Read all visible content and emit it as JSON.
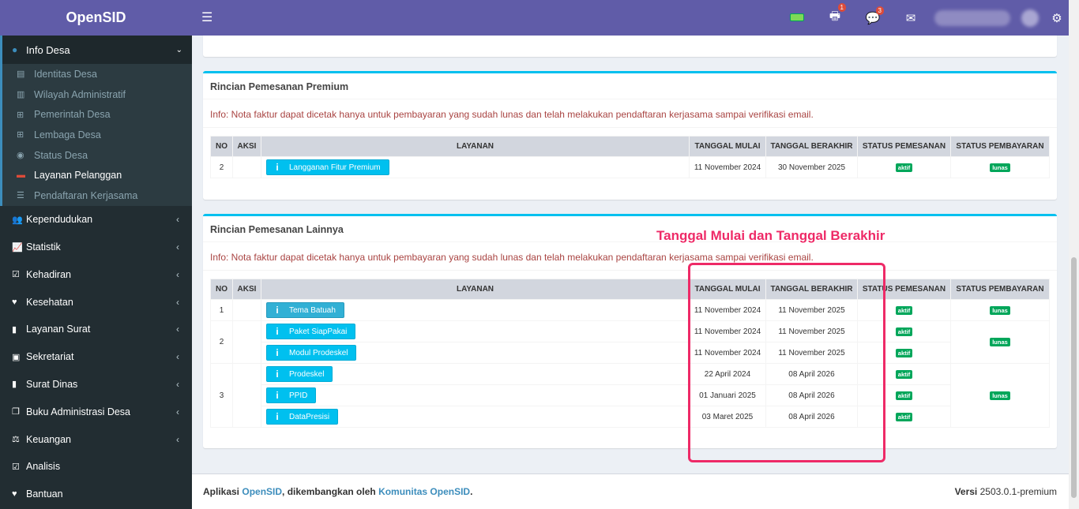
{
  "brand": "OpenSID",
  "sidebar": {
    "open_menu": {
      "label": "Info Desa",
      "icon": "palette-icon"
    },
    "sub_items": [
      {
        "label": "Identitas Desa",
        "icon": "id-card-icon"
      },
      {
        "label": "Wilayah Administratif",
        "icon": "map-icon"
      },
      {
        "label": "Pemerintah Desa",
        "icon": "sitemap-icon"
      },
      {
        "label": "Lembaga Desa",
        "icon": "sitemap-icon"
      },
      {
        "label": "Status Desa",
        "icon": "dot-circle-icon"
      },
      {
        "label": "Layanan Pelanggan",
        "icon": "credit-card-icon"
      },
      {
        "label": "Pendaftaran Kerjasama",
        "icon": "list-icon"
      }
    ],
    "items": [
      {
        "label": "Kependudukan",
        "icon": "users-icon"
      },
      {
        "label": "Statistik",
        "icon": "line-chart-icon"
      },
      {
        "label": "Kehadiran",
        "icon": "calendar-check-icon"
      },
      {
        "label": "Kesehatan",
        "icon": "heartbeat-icon"
      },
      {
        "label": "Layanan Surat",
        "icon": "book-icon"
      },
      {
        "label": "Sekretariat",
        "icon": "archive-icon"
      },
      {
        "label": "Surat Dinas",
        "icon": "book-icon"
      },
      {
        "label": "Buku Administrasi Desa",
        "icon": "copy-icon"
      },
      {
        "label": "Keuangan",
        "icon": "balance-scale-icon"
      },
      {
        "label": "Analisis",
        "icon": "check-square-icon"
      },
      {
        "label": "Bantuan",
        "icon": "heart-icon"
      }
    ]
  },
  "topbar": {
    "print_badge": "1",
    "chat_badge": "3"
  },
  "premium": {
    "title": "Rincian Pemesanan Premium",
    "info": "Info: Nota faktur dapat dicetak hanya untuk pembayaran yang sudah lunas dan telah melakukan pendaftaran kerjasama sampai verifikasi email.",
    "headers": [
      "NO",
      "AKSI",
      "LAYANAN",
      "TANGGAL MULAI",
      "TANGGAL BERAKHIR",
      "STATUS PEMESANAN",
      "STATUS PEMBAYARAN"
    ],
    "row": {
      "no": "2",
      "layanan": "Langganan Fitur Premium",
      "mulai": "11 November 2024",
      "berakhir": "30 November 2025",
      "status_pesan": "aktif",
      "status_bayar": "lunas"
    }
  },
  "lainnya": {
    "title": "Rincian Pemesanan Lainnya",
    "info": "Info: Nota faktur dapat dicetak hanya untuk pembayaran yang sudah lunas dan telah melakukan pendaftaran kerjasama sampai verifikasi email.",
    "headers": [
      "NO",
      "AKSI",
      "LAYANAN",
      "TANGGAL MULAI",
      "TANGGAL BERAKHIR",
      "STATUS PEMESANAN",
      "STATUS PEMBAYARAN"
    ],
    "rows": [
      {
        "no": "1",
        "layanan": "Tema Batuah",
        "mulai": "11 November 2024",
        "berakhir": "11 November 2025",
        "status_pesan": "aktif",
        "status_bayar": "lunas"
      },
      {
        "no": "2",
        "layanan": "Paket SiapPakai",
        "mulai": "11 November 2024",
        "berakhir": "11 November 2025",
        "status_pesan": "aktif",
        "status_bayar": "lunas"
      },
      {
        "no": "",
        "layanan": "Modul Prodeskel",
        "mulai": "11 November 2024",
        "berakhir": "11 November 2025",
        "status_pesan": "aktif",
        "status_bayar": ""
      },
      {
        "no": "3",
        "layanan": "Prodeskel",
        "mulai": "22 April 2024",
        "berakhir": "08 April 2026",
        "status_pesan": "aktif",
        "status_bayar": "lunas"
      },
      {
        "no": "",
        "layanan": "PPID",
        "mulai": "01 Januari 2025",
        "berakhir": "08 April 2026",
        "status_pesan": "aktif",
        "status_bayar": ""
      },
      {
        "no": "",
        "layanan": "DataPresisi",
        "mulai": "03 Maret 2025",
        "berakhir": "08 April 2026",
        "status_pesan": "aktif",
        "status_bayar": ""
      }
    ]
  },
  "annotation": "Tanggal Mulai dan Tanggal Berakhir",
  "footer": {
    "prefix": "Aplikasi ",
    "app": "OpenSID",
    "middle": ", dikembangkan oleh ",
    "community": "Komunitas OpenSID",
    "suffix": ".",
    "version_label": "Versi",
    "version": "2503.0.1-premium"
  },
  "colors": {
    "brand": "#605ca8",
    "sidebar": "#222d32",
    "info": "#00c0ef",
    "success": "#00a65a",
    "annotation": "#ee2a67"
  }
}
